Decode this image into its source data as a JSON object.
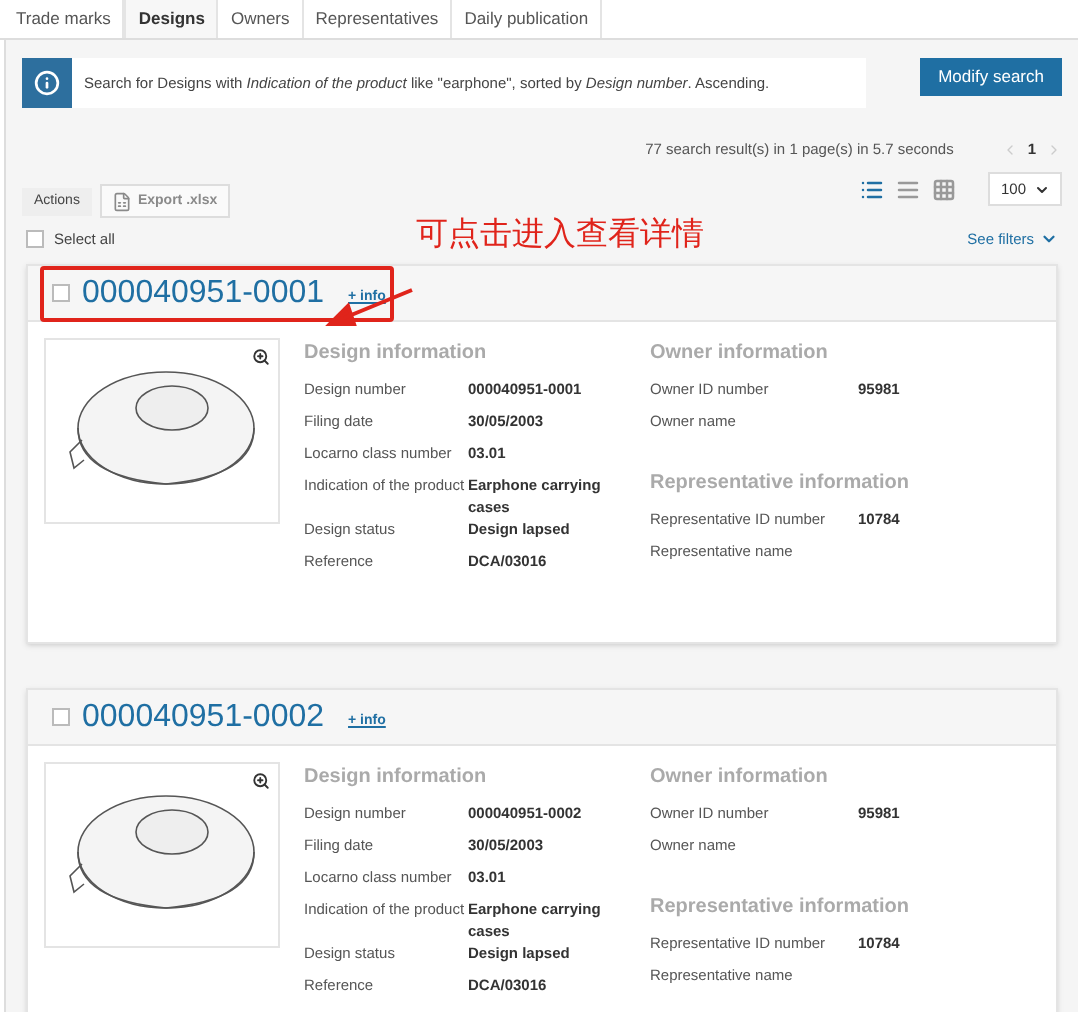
{
  "tabs": [
    {
      "label": "Trade marks",
      "selected": false
    },
    {
      "label": "Designs",
      "selected": true
    },
    {
      "label": "Owners",
      "selected": false
    },
    {
      "label": "Representatives",
      "selected": false
    },
    {
      "label": "Daily publication",
      "selected": false
    }
  ],
  "search_info": {
    "text": "Search for Designs with *Indication of the product* like \"earphone\", sorted by *Design number*. Ascending.",
    "button": "Modify search"
  },
  "results_summary": "77 search result(s) in 1 page(s) in 5.7 seconds",
  "pagination": {
    "page": "1"
  },
  "view_modes": [
    {
      "kind": "list",
      "selected": true
    },
    {
      "kind": "compact",
      "selected": false
    },
    {
      "kind": "grid",
      "selected": false
    }
  ],
  "per_page": "100",
  "actions": {
    "label": "Actions",
    "export": {
      "label": "Export .xlsx",
      "disabled": true
    }
  },
  "select_all": {
    "label": "Select all",
    "checked": false
  },
  "see_filters": "See filters",
  "annotation": {
    "text": "可点击进入查看详情"
  },
  "results": [
    {
      "number": "000040951-0001",
      "info_link": "+ info",
      "checked": false,
      "highlighted": true,
      "design_heading": "Design information",
      "design_fields": [
        {
          "label": "Design number",
          "value": "000040951-0001"
        },
        {
          "label": "Filing date",
          "value": "30/05/2003"
        },
        {
          "label": "Locarno class number",
          "value": "03.01"
        },
        {
          "label": "Indication of the product",
          "value": "Earphone carrying cases"
        },
        {
          "label": "Design status",
          "value": "Design lapsed"
        },
        {
          "label": "Reference",
          "value": "DCA/03016"
        }
      ],
      "owner_heading": "Owner information",
      "owner_fields": [
        {
          "label": "Owner ID number",
          "value": "95981"
        },
        {
          "label": "Owner name"
        }
      ],
      "rep_heading": "Representative information",
      "rep_fields": [
        {
          "label": "Representative ID number",
          "value": "10784"
        },
        {
          "label": "Representative name"
        }
      ]
    },
    {
      "number": "000040951-0002",
      "info_link": "+ info",
      "checked": false,
      "highlighted": false,
      "design_heading": "Design information",
      "design_fields": [
        {
          "label": "Design number",
          "value": "000040951-0002"
        },
        {
          "label": "Filing date",
          "value": "30/05/2003"
        },
        {
          "label": "Locarno class number",
          "value": "03.01"
        },
        {
          "label": "Indication of the product",
          "value": "Earphone carrying cases"
        },
        {
          "label": "Design status",
          "value": "Design lapsed"
        },
        {
          "label": "Reference",
          "value": "DCA/03016"
        }
      ],
      "owner_heading": "Owner information",
      "owner_fields": [
        {
          "label": "Owner ID number",
          "value": "95981"
        },
        {
          "label": "Owner name"
        }
      ],
      "rep_heading": "Representative information",
      "rep_fields": [
        {
          "label": "Representative ID number",
          "value": "10784"
        },
        {
          "label": "Representative name"
        }
      ]
    }
  ]
}
